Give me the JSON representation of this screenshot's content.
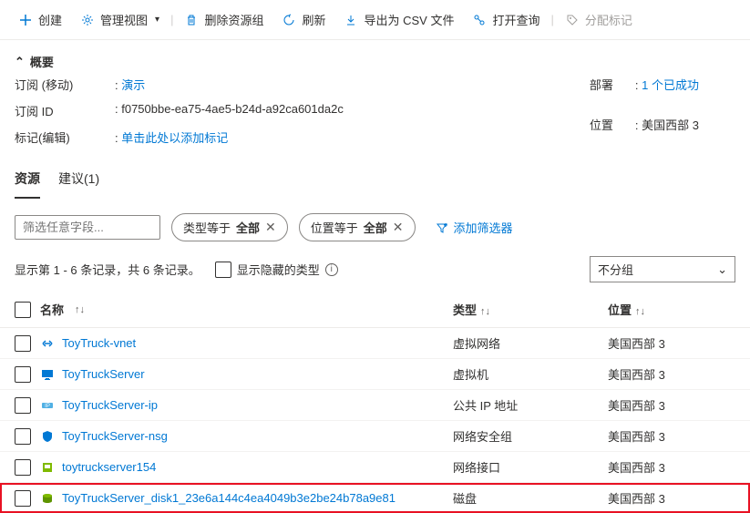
{
  "toolbar": {
    "create": "创建",
    "manage_view": "管理视图",
    "delete_rg": "删除资源组",
    "refresh": "刷新",
    "export_csv": "导出为 CSV 文件",
    "open_query": "打开查询",
    "assign_tags": "分配标记"
  },
  "summary": {
    "header": "概要",
    "subscription_label": "订阅 (移动)",
    "subscription_value": "演示",
    "subscription_id_label": "订阅 ID",
    "subscription_id_value": "f0750bbe-ea75-4ae5-b24d-a92ca601da2c",
    "tags_label": "标记(编辑)",
    "tags_value": "单击此处以添加标记",
    "deployments_label": "部署",
    "deployments_value": "1 个已成功",
    "location_label": "位置",
    "location_value": "美国西部 3"
  },
  "tabs": {
    "resources": "资源",
    "suggestions": "建议(1)"
  },
  "filter": {
    "placeholder": "筛选任意字段...",
    "type_pill_prefix": "类型等于 ",
    "type_pill_value": "全部",
    "location_pill_prefix": "位置等于 ",
    "location_pill_value": "全部",
    "add_filter": "添加筛选器"
  },
  "list_controls": {
    "record_text": "显示第 1 - 6 条记录，共 6 条记录。",
    "show_hidden": "显示隐藏的类型",
    "group_by": "不分组"
  },
  "columns": {
    "name": "名称",
    "type": "类型",
    "location": "位置"
  },
  "resources": [
    {
      "name": "ToyTruck-vnet",
      "type": "虚拟网络",
      "location": "美国西部 3",
      "icon": "vnet"
    },
    {
      "name": "ToyTruckServer",
      "type": "虚拟机",
      "location": "美国西部 3",
      "icon": "vm"
    },
    {
      "name": "ToyTruckServer-ip",
      "type": "公共 IP 地址",
      "location": "美国西部 3",
      "icon": "ip"
    },
    {
      "name": "ToyTruckServer-nsg",
      "type": "网络安全组",
      "location": "美国西部 3",
      "icon": "nsg"
    },
    {
      "name": "toytruckserver154",
      "type": "网络接口",
      "location": "美国西部 3",
      "icon": "nic"
    },
    {
      "name": "ToyTruckServer_disk1_23e6a144c4ea4049b3e2be24b78a9e81",
      "type": "磁盘",
      "location": "美国西部 3",
      "icon": "disk"
    }
  ]
}
